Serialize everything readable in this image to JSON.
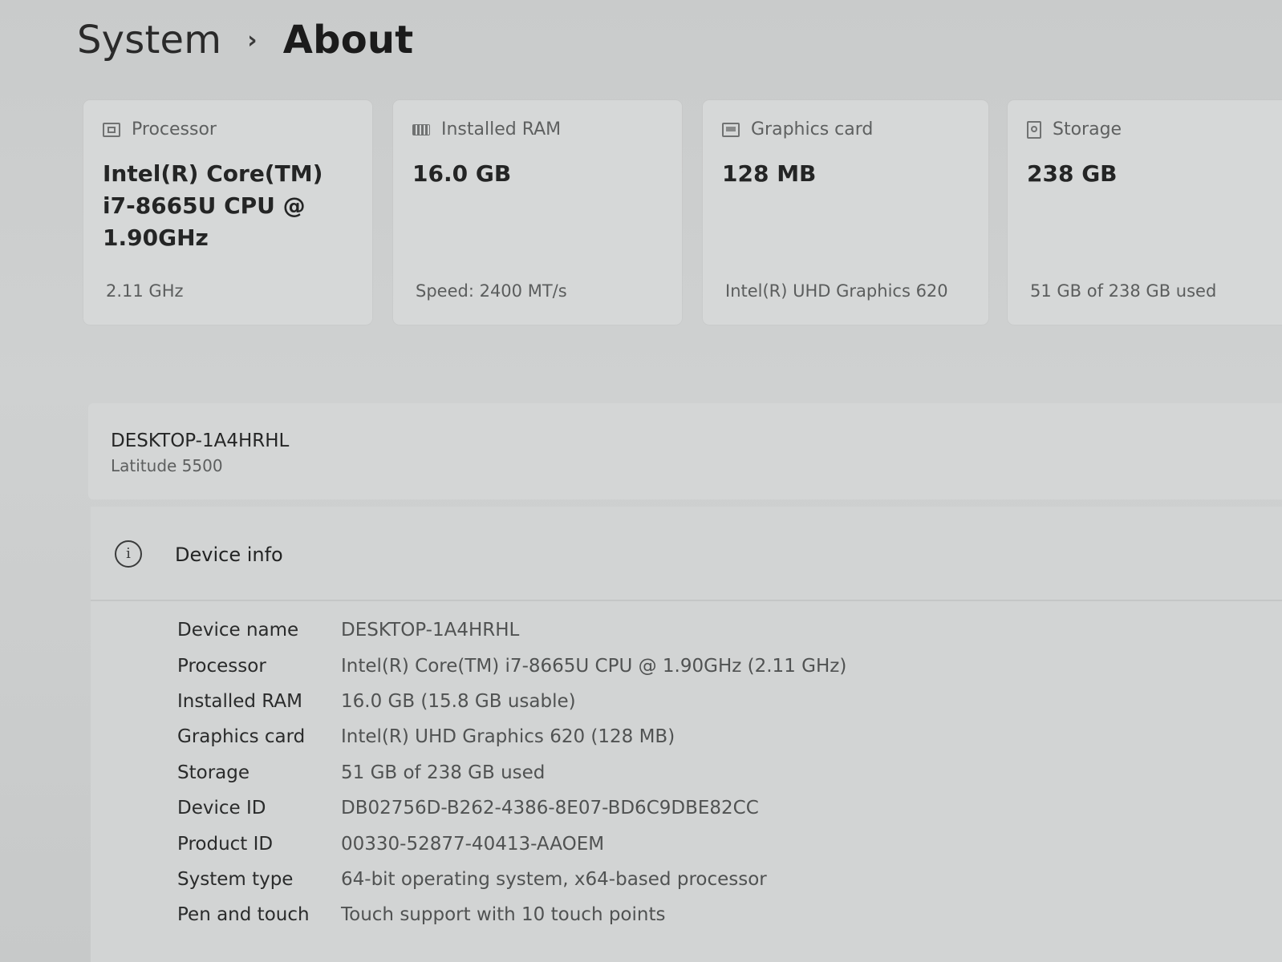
{
  "breadcrumb": {
    "parent": "System",
    "separator": "›",
    "current": "About"
  },
  "cards": [
    {
      "icon": "processor-icon",
      "label": "Processor",
      "value": "Intel(R) Core(TM) i7-8665U CPU @ 1.90GHz",
      "sub": "2.11 GHz"
    },
    {
      "icon": "ram-icon",
      "label": "Installed RAM",
      "value": "16.0 GB",
      "sub": "Speed: 2400 MT/s"
    },
    {
      "icon": "graphics-card-icon",
      "label": "Graphics card",
      "value": "128 MB",
      "sub": "Intel(R) UHD Graphics 620"
    },
    {
      "icon": "storage-icon",
      "label": "Storage",
      "value": "238 GB",
      "sub": "51 GB of 238 GB used"
    }
  ],
  "device": {
    "name": "DESKTOP-1A4HRHL",
    "model": "Latitude 5500"
  },
  "device_info": {
    "icon": "info-icon",
    "icon_glyph": "i",
    "title": "Device info",
    "rows": [
      {
        "label": "Device name",
        "value": "DESKTOP-1A4HRHL"
      },
      {
        "label": "Processor",
        "value": "Intel(R) Core(TM) i7-8665U CPU @ 1.90GHz (2.11 GHz)"
      },
      {
        "label": "Installed RAM",
        "value": "16.0 GB (15.8 GB usable)"
      },
      {
        "label": "Graphics card",
        "value": "Intel(R) UHD Graphics 620 (128 MB)"
      },
      {
        "label": "Storage",
        "value": "51 GB of 238 GB used"
      },
      {
        "label": "Device ID",
        "value": "DB02756D-B262-4386-8E07-BD6C9DBE82CC"
      },
      {
        "label": "Product ID",
        "value": "00330-52877-40413-AAOEM"
      },
      {
        "label": "System type",
        "value": "64-bit operating system, x64-based processor"
      },
      {
        "label": "Pen and touch",
        "value": "Touch support with 10 touch points"
      }
    ]
  }
}
